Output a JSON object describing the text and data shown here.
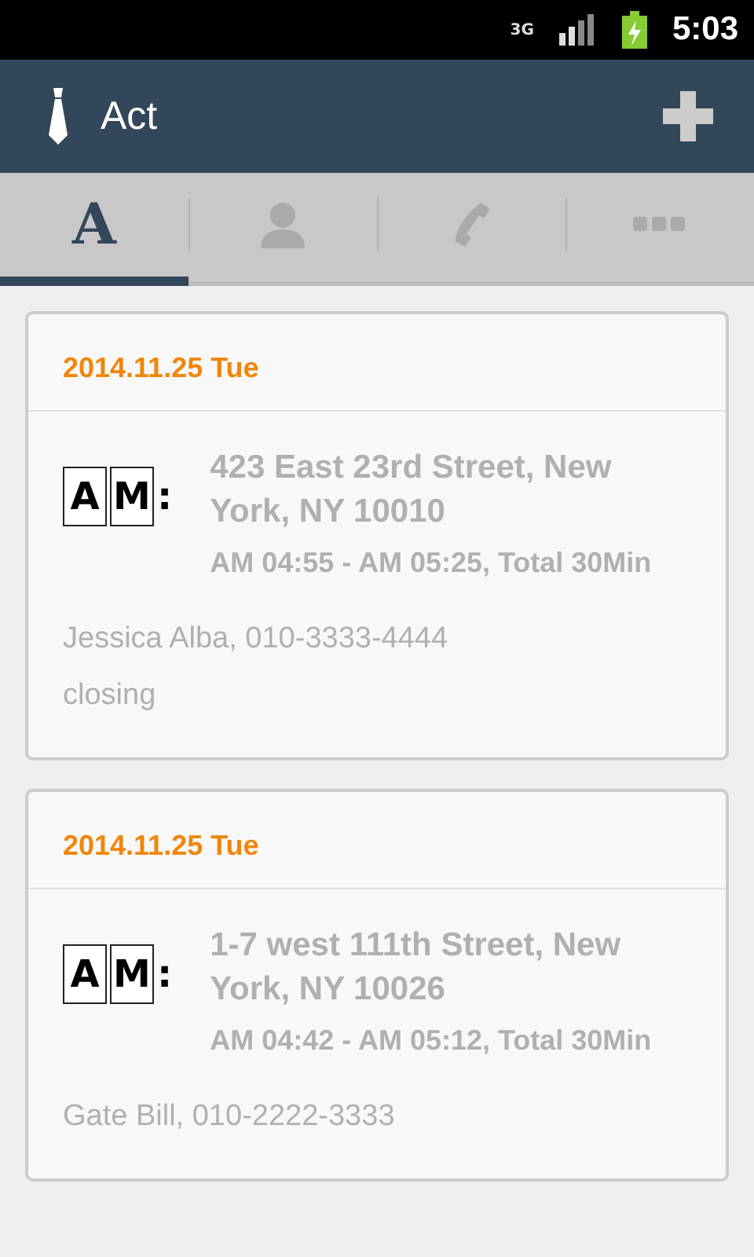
{
  "status_bar": {
    "network": "3G",
    "time": "5:03"
  },
  "app_bar": {
    "title": "Act"
  },
  "tabs": [
    {
      "kind": "letter",
      "label": "A",
      "selected": true
    },
    {
      "kind": "person",
      "selected": false
    },
    {
      "kind": "phone",
      "selected": false
    },
    {
      "kind": "more",
      "selected": false
    }
  ],
  "entries": [
    {
      "date": "2014.11.25 Tue",
      "tiles": [
        "A",
        "M"
      ],
      "separator": ":",
      "address": "423 East 23rd Street, New York, NY 10010",
      "time": "AM 04:55 - AM 05:25, Total 30Min",
      "contact": "Jessica Alba, 010-3333-4444",
      "note": "closing"
    },
    {
      "date": "2014.11.25 Tue",
      "tiles": [
        "A",
        "M"
      ],
      "separator": ":",
      "address": "1-7 west 111th Street, New York, NY 10026",
      "time": "AM 04:42 - AM 05:12, Total 30Min",
      "contact": "Gate Bill, 010-2222-3333"
    }
  ]
}
